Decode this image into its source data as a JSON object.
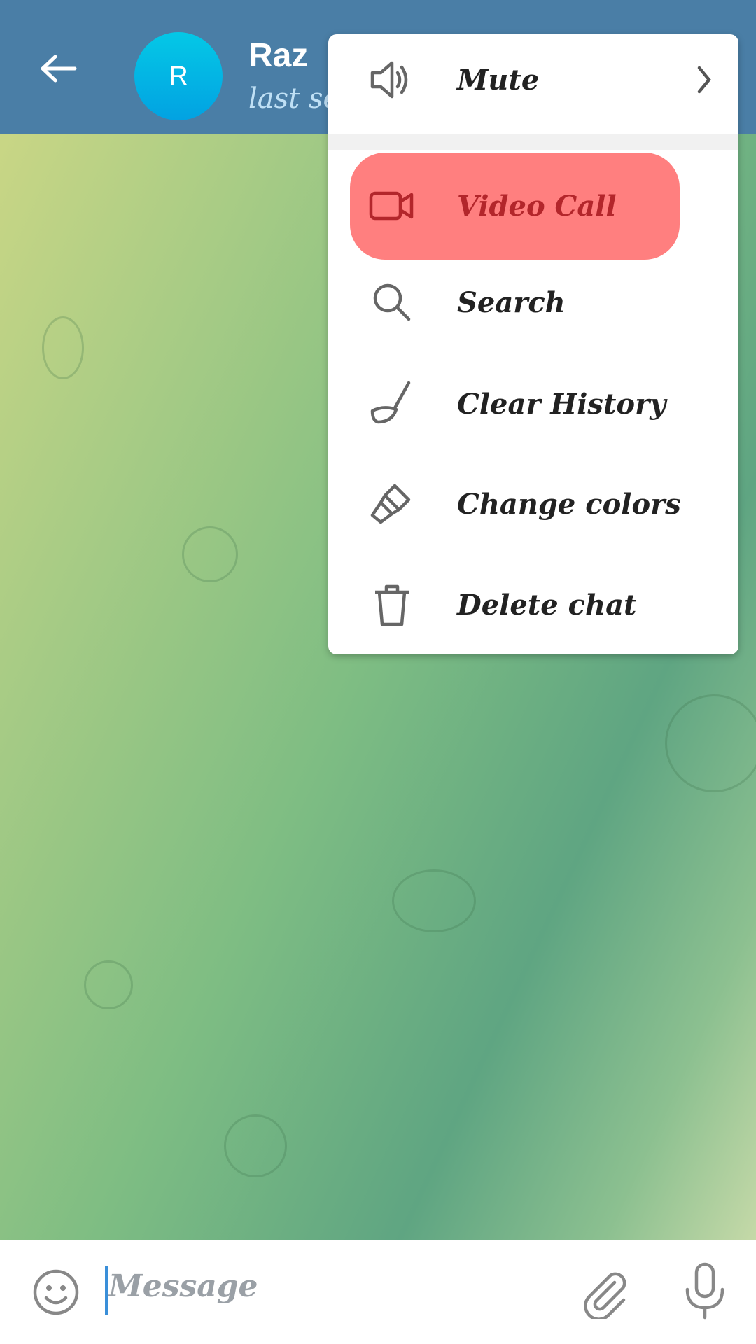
{
  "header": {
    "contact_name": "Raz",
    "avatar_letter": "R",
    "status": "last seen recently",
    "back_icon": "arrow-left-icon"
  },
  "menu": {
    "items": [
      {
        "label": "Mute",
        "icon": "speaker-icon",
        "has_submenu": true
      },
      {
        "label": "Video Call",
        "icon": "video-camera-icon",
        "highlighted": true
      },
      {
        "label": "Search",
        "icon": "search-icon"
      },
      {
        "label": "Clear History",
        "icon": "broom-icon"
      },
      {
        "label": "Change colors",
        "icon": "paint-brush-icon"
      },
      {
        "label": "Delete chat",
        "icon": "trash-icon"
      }
    ]
  },
  "input": {
    "placeholder": "Message",
    "emoji_icon": "emoji-icon",
    "attach_icon": "paperclip-icon",
    "mic_icon": "microphone-icon"
  },
  "colors": {
    "header": "#4a7ea6",
    "highlight": "#ff7f7f",
    "highlight_text": "#b3262b"
  }
}
